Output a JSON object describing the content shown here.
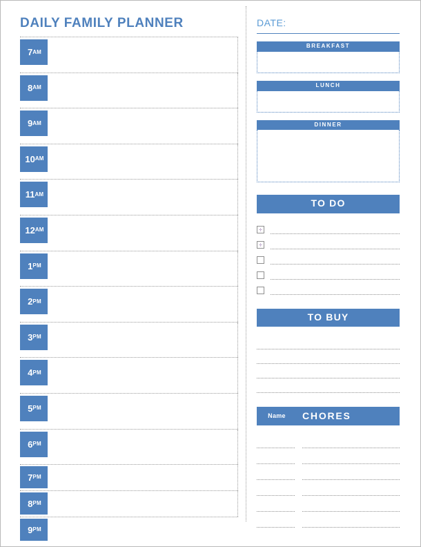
{
  "colors": {
    "accent_blue": "#4f81bd",
    "title_blue": "#4f81bd",
    "date_blue": "#5b9bd5",
    "dotted_gray": "#8f8f8f",
    "page_border": "#b9b9b9",
    "checkbox_mark": "#c9b7d4"
  },
  "left": {
    "title": "DAILY FAMILY PLANNER",
    "schedule": [
      {
        "hour": "7",
        "ampm": "AM",
        "short": false
      },
      {
        "hour": "8",
        "ampm": "AM",
        "short": false
      },
      {
        "hour": "9",
        "ampm": "AM",
        "short": false
      },
      {
        "hour": "10",
        "ampm": "AM",
        "short": false
      },
      {
        "hour": "11",
        "ampm": "AM",
        "short": false
      },
      {
        "hour": "12",
        "ampm": "AM",
        "short": false
      },
      {
        "hour": "1",
        "ampm": "PM",
        "short": false
      },
      {
        "hour": "2",
        "ampm": "PM",
        "short": false
      },
      {
        "hour": "3",
        "ampm": "PM",
        "short": false
      },
      {
        "hour": "4",
        "ampm": "PM",
        "short": false
      },
      {
        "hour": "5",
        "ampm": "PM",
        "short": false
      },
      {
        "hour": "6",
        "ampm": "PM",
        "short": false
      },
      {
        "hour": "7",
        "ampm": "PM",
        "short": true
      },
      {
        "hour": "8",
        "ampm": "PM",
        "short": true
      },
      {
        "hour": "9",
        "ampm": "PM",
        "short": true
      }
    ]
  },
  "right": {
    "date": {
      "label": "DATE:",
      "value": ""
    },
    "meals": [
      {
        "label": "BREAKFAST",
        "value": "",
        "tall": false
      },
      {
        "label": "LUNCH",
        "value": "",
        "tall": false
      },
      {
        "label": "DINNER",
        "value": "",
        "tall": true
      }
    ],
    "todo": {
      "title": "TO DO",
      "items": [
        {
          "checked": true,
          "text": ""
        },
        {
          "checked": true,
          "text": ""
        },
        {
          "checked": false,
          "text": ""
        },
        {
          "checked": false,
          "text": ""
        },
        {
          "checked": false,
          "text": ""
        }
      ]
    },
    "tobuy": {
      "title": "TO BUY",
      "items": [
        {
          "text": ""
        },
        {
          "text": ""
        },
        {
          "text": ""
        },
        {
          "text": ""
        }
      ]
    },
    "chores": {
      "name_header": "Name",
      "title": "CHORES",
      "rows": [
        {
          "name": "",
          "task": ""
        },
        {
          "name": "",
          "task": ""
        },
        {
          "name": "",
          "task": ""
        },
        {
          "name": "",
          "task": ""
        },
        {
          "name": "",
          "task": ""
        },
        {
          "name": "",
          "task": ""
        }
      ]
    }
  }
}
